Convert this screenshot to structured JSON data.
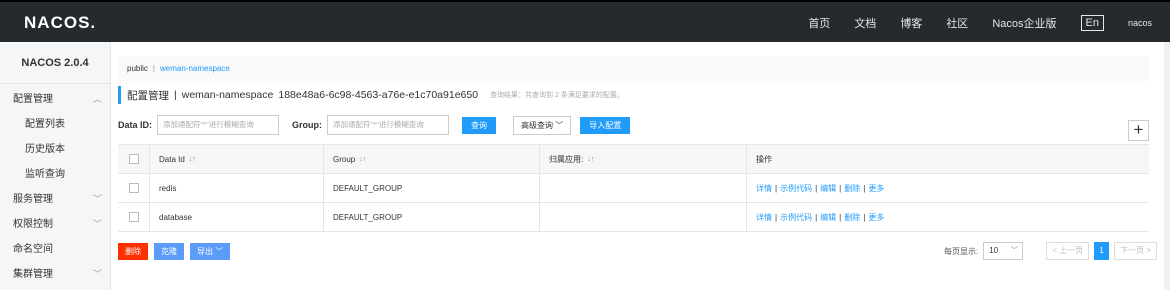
{
  "topbar": {
    "logo_a": "NA",
    "logo_b": "C",
    "logo_c": "OS.",
    "nav": [
      "首页",
      "文档",
      "博客",
      "社区",
      "Nacos企业版"
    ],
    "lang": "En",
    "user": "nacos"
  },
  "sidebar": {
    "version": "NACOS 2.0.4",
    "items": [
      {
        "label": "配置管理",
        "arrow": "^"
      },
      {
        "label": "配置列表"
      },
      {
        "label": "历史版本"
      },
      {
        "label": "监听查询"
      },
      {
        "label": "服务管理",
        "arrow": "v"
      },
      {
        "label": "权限控制",
        "arrow": "v"
      },
      {
        "label": "命名空间"
      },
      {
        "label": "集群管理",
        "arrow": "v"
      }
    ]
  },
  "breadcrumb": {
    "public": "public",
    "sep": "|",
    "namespace": "weman-namespace"
  },
  "title": {
    "main": "配置管理",
    "sep": "|",
    "ns_name": "weman-namespace",
    "ns_id": "188e48a6-6c98-4563-a76e-e1c70a91e650",
    "hint": "查询结果：共查询到 2 条满足要求的配置。"
  },
  "filters": {
    "dataid_label": "Data ID:",
    "dataid_placeholder": "添加通配符\"*\"进行模糊查询",
    "group_label": "Group:",
    "group_placeholder": "添加通配符\"*\"进行模糊查询",
    "query_button": "查询",
    "advanced_button": "高级查询",
    "import_button": "导入配置"
  },
  "table": {
    "headers": {
      "data_id": "Data Id",
      "group": "Group",
      "app": "归属应用:",
      "ops": "操作"
    },
    "sort_icon": "↓↑",
    "rows": [
      {
        "data_id": "redis",
        "group": "DEFAULT_GROUP",
        "app": ""
      },
      {
        "data_id": "database",
        "group": "DEFAULT_GROUP",
        "app": ""
      }
    ],
    "ops": {
      "detail": "详情",
      "sample": "示例代码",
      "edit": "编辑",
      "delete": "删除",
      "more": "更多",
      "sep": "|"
    }
  },
  "bottom": {
    "delete": "删除",
    "clone": "克隆",
    "export": "导出"
  },
  "pager": {
    "label": "每页显示:",
    "page_size": "10",
    "prev": "< 上一页",
    "current": "1",
    "next": "下一页 >"
  },
  "colors": {
    "accent": "#209bfa",
    "danger": "#ff3000",
    "topbar": "#252a2f"
  }
}
